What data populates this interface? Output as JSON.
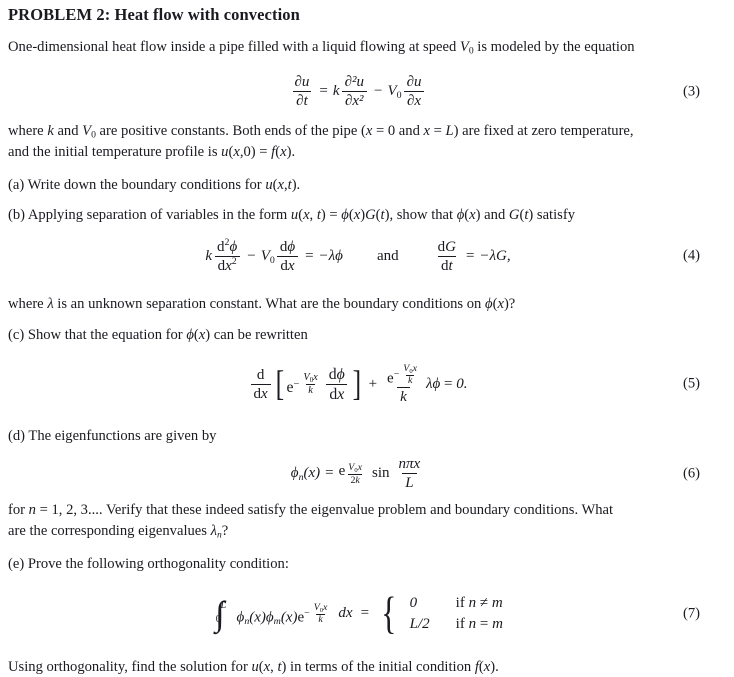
{
  "document": {
    "title_prefix": "PROBLEM 2:",
    "title_text": "Heat flow with convection",
    "intro": "One-dimensional heat flow inside a pipe filled with a liquid flowing at speed V₀ is modeled by the equation",
    "after_eq3_line1": "where k and V₀ are positive constants. Both ends of the pipe (x = 0 and x = L) are fixed at zero temperature,",
    "after_eq3_line2": "and the initial temperature profile is u(x,0) = f(x).",
    "item_a": "(a) Write down the boundary conditions for u(x, t).",
    "item_b": "(b) Applying separation of variables in the form u(x, t) = ϕ(x)G(t), show that ϕ(x) and G(t) satisfy",
    "after_eq4": "where λ is an unknown separation constant. What are the boundary conditions on ϕ(x)?",
    "item_c": "(c) Show that the equation for ϕ(x) can be rewritten",
    "item_d": "(d) The eigenfunctions are given by",
    "after_eq6_line1": "for n = 1, 2, 3.... Verify that these indeed satisfy the eigenvalue problem and boundary conditions. What",
    "after_eq6_line2": "are the corresponding eigenvalues λₙ?",
    "item_e": "(e) Prove the following orthogonality condition:",
    "closing": "Using orthogonality, find the solution for u(x, t) in terms of the initial condition f(x)."
  },
  "equations": {
    "eq3": {
      "number": "(3)",
      "latex": "\\frac{\\partial u}{\\partial t} = k\\frac{\\partial^2 u}{\\partial x^2} - V_0\\frac{\\partial u}{\\partial x}",
      "parts": {
        "lhs_num": "∂u",
        "lhs_den": "∂t",
        "equals": "=",
        "k": "k",
        "t1_num": "∂²u",
        "t1_den": "∂x²",
        "minus": "−",
        "V0": "V",
        "V0sub": "0",
        "t2_num": "∂u",
        "t2_den": "∂x"
      }
    },
    "eq4": {
      "number": "(4)",
      "latex": "k\\frac{d^2\\phi}{dx^2} - V_0\\frac{d\\phi}{dx} = -\\lambda\\phi \\quad \\text{and} \\quad \\frac{dG}{dt} = -\\lambda G,",
      "parts": {
        "k": "k",
        "t1_num": "d²ϕ",
        "t1_den": "dx²",
        "minus": "−",
        "V0": "V",
        "V0sub": "0",
        "t2_num": "dϕ",
        "t2_den": "dx",
        "equals": "=",
        "rhs": "−λϕ",
        "and": "and",
        "t3_num": "dG",
        "t3_den": "dt",
        "equals2": "=",
        "rhs2": "−λG,"
      }
    },
    "eq5": {
      "number": "(5)",
      "latex": "\\frac{d}{dx}\\left[e^{-\\frac{V_0 x}{k}}\\frac{d\\phi}{dx}\\right] + \\frac{e^{-\\frac{V_0 x}{k}}}{k}\\lambda\\phi = 0.",
      "parts": {
        "d_num": "d",
        "d_den": "dx",
        "e": "e",
        "exp_sign": "−",
        "exp_num": "V₀x",
        "exp_den": "k",
        "inner_num": "dϕ",
        "inner_den": "dx",
        "plus": "+",
        "frac_den": "k",
        "tail": "λϕ = 0."
      }
    },
    "eq6": {
      "number": "(6)",
      "latex": "\\phi_n(x) = e^{\\frac{V_0 x}{2k}}\\sin\\frac{n\\pi x}{L}",
      "parts": {
        "lhs": "ϕ",
        "lhs_sub": "n",
        "lhs_arg": "(x)",
        "equals": "=",
        "e": "e",
        "exp_num": "V₀x",
        "exp_den": "2k",
        "sin": "sin",
        "arg_num": "nπx",
        "arg_den": "L"
      }
    },
    "eq7": {
      "number": "(7)",
      "latex": "\\int_0^L \\phi_n(x)\\phi_m(x)e^{-\\frac{V_0 x}{k}}\\,dx = \\begin{cases} 0 & \\text{if } n \\neq m \\\\ L/2 & \\text{if } n = m \\end{cases}",
      "parts": {
        "int_upper": "L",
        "int_lower": "0",
        "integrand": "ϕₙ(x)ϕₘ(x)e",
        "exp_sign": "−",
        "exp_num": "V₀x",
        "exp_den": "k",
        "dx": "dx",
        "equals": "=",
        "case1_value": "0",
        "case1_cond": "if n ≠ m",
        "case2_value": "L/2",
        "case2_cond": "if n = m"
      }
    }
  }
}
